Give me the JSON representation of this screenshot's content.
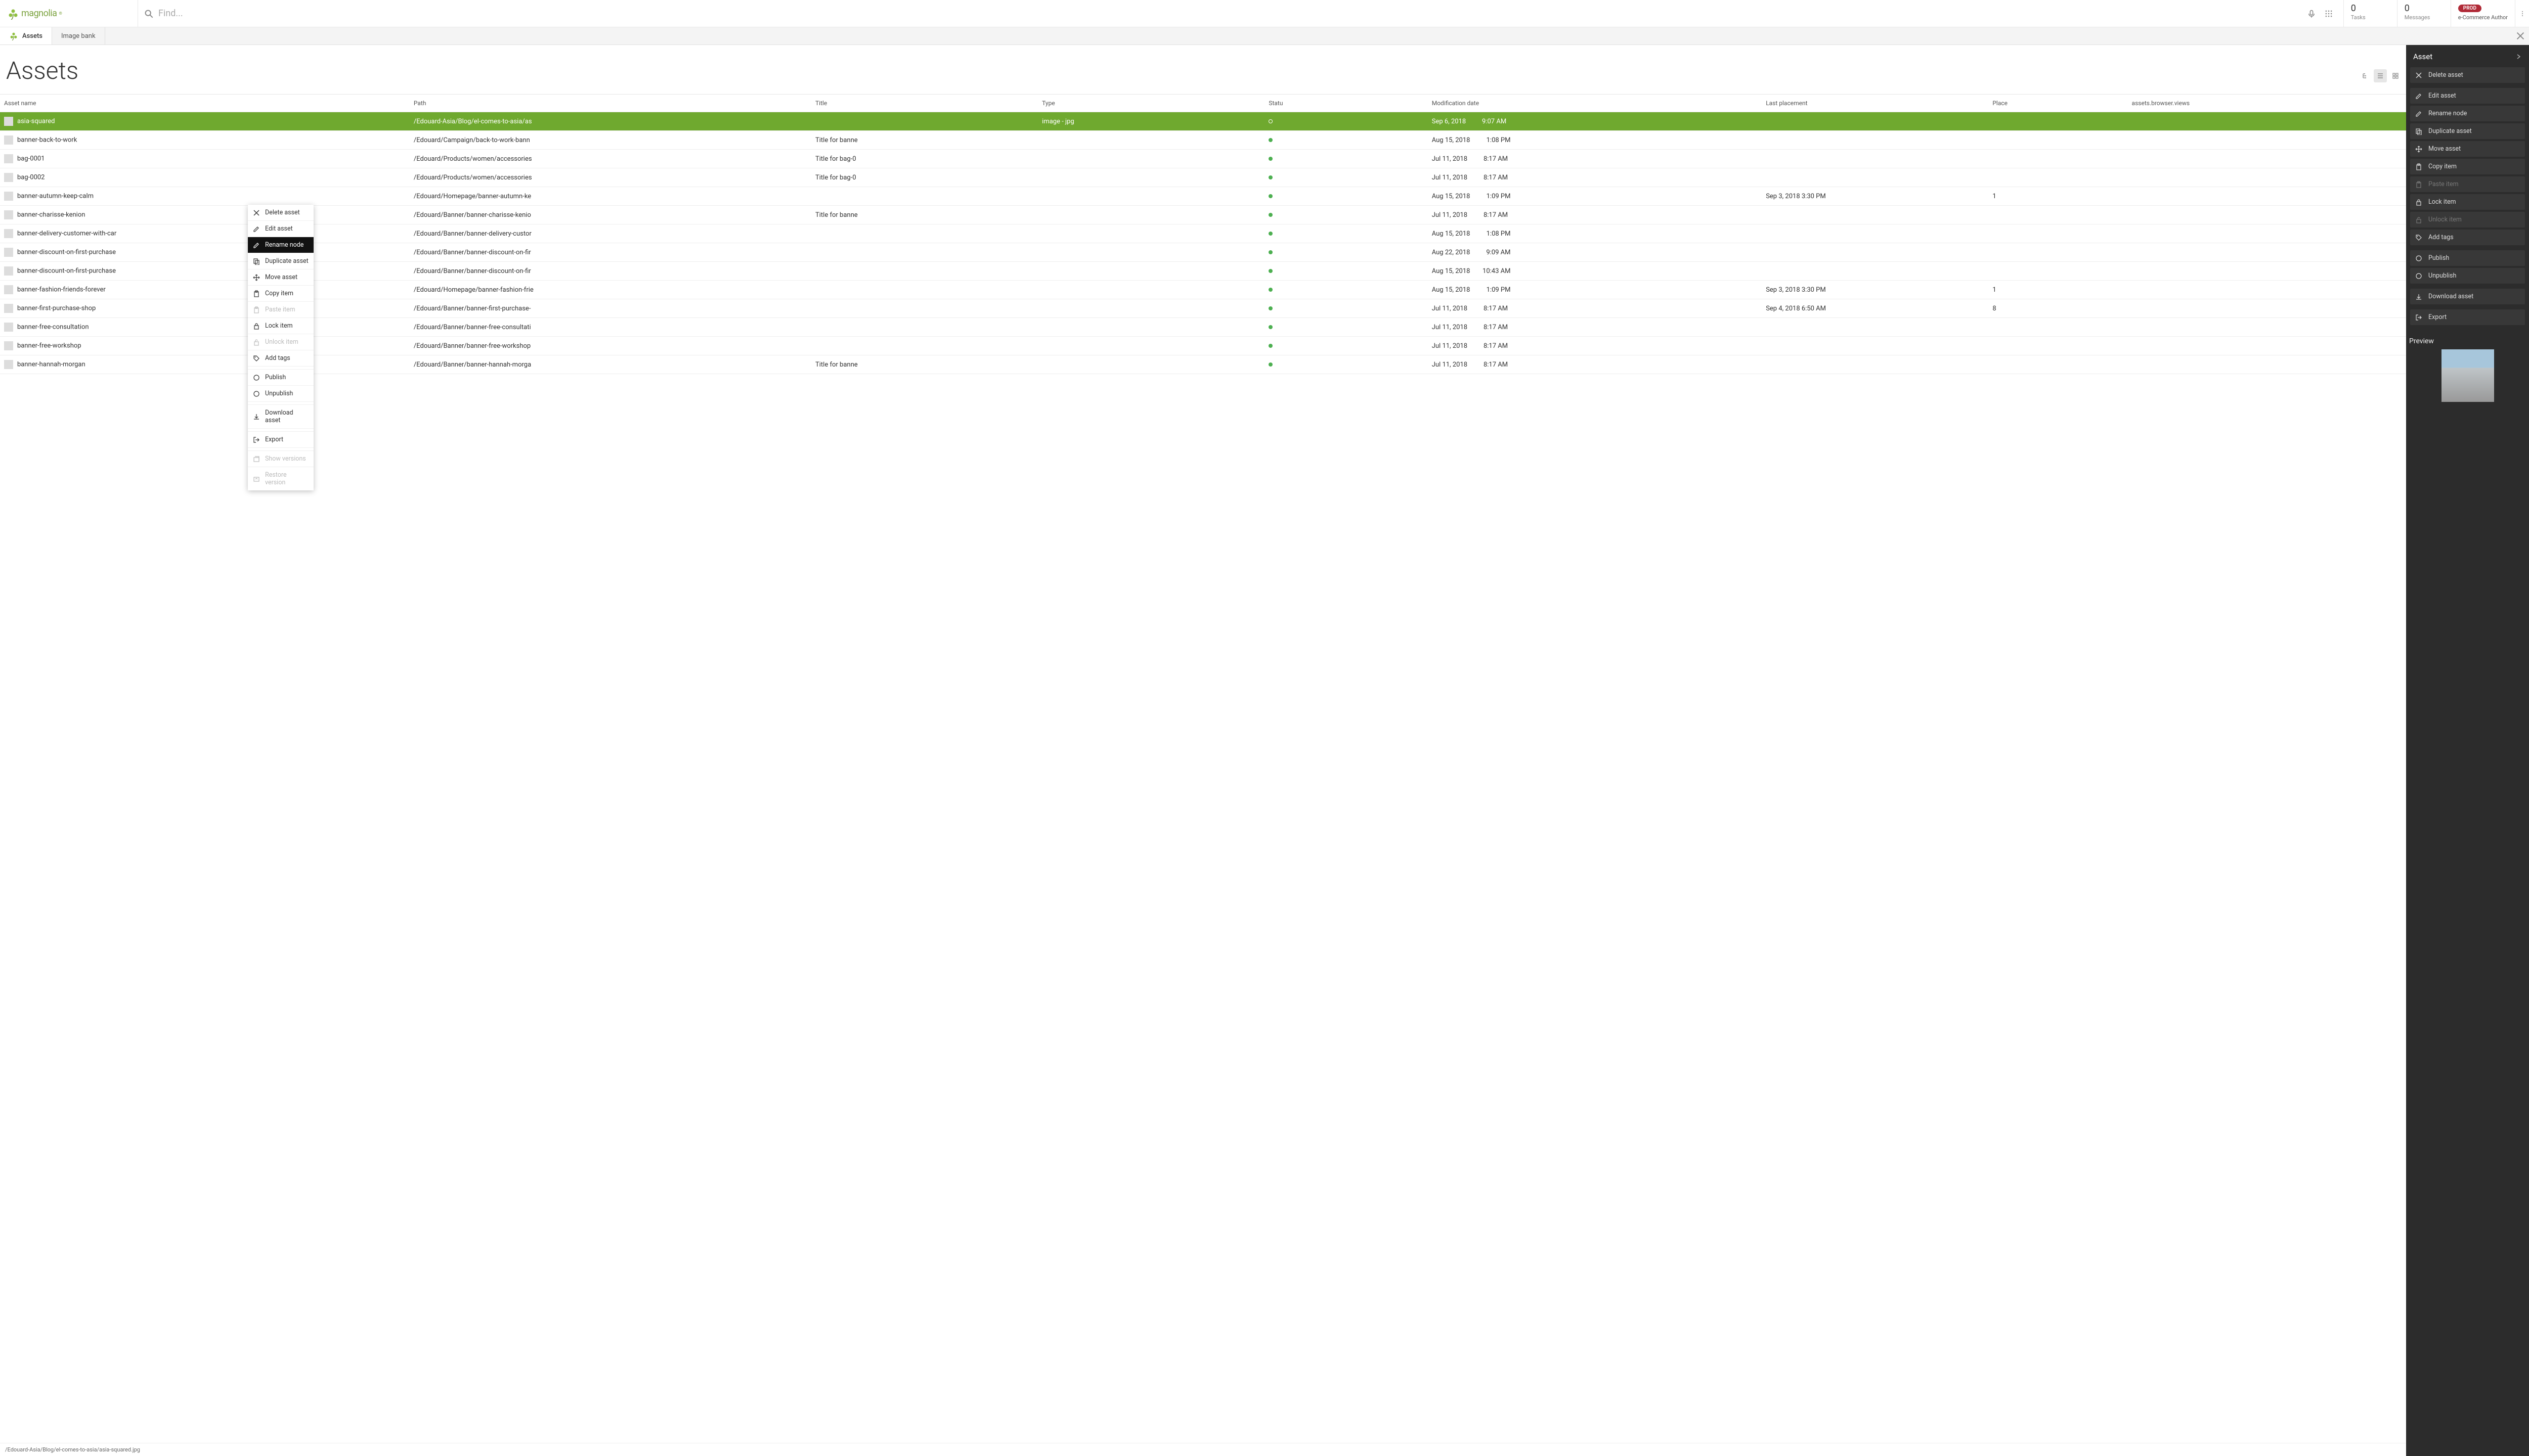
{
  "brand": {
    "name": "magnolia"
  },
  "search": {
    "placeholder": "Find..."
  },
  "header_stats": {
    "tasks": {
      "count": "0",
      "label": "Tasks"
    },
    "messages": {
      "count": "0",
      "label": "Messages"
    }
  },
  "env": {
    "badge": "PROD",
    "role": "e-Commerce Author"
  },
  "tabs": [
    {
      "label": "Assets",
      "active": true
    },
    {
      "label": "Image bank",
      "active": false
    }
  ],
  "page_title": "Assets",
  "columns": {
    "name": "Asset name",
    "path": "Path",
    "title": "Title",
    "type": "Type",
    "status": "Statu",
    "mod": "Modification date",
    "last": "Last placement",
    "place": "Place",
    "views": "assets.browser.views"
  },
  "rows": [
    {
      "name": "asia-squared",
      "path": "/Edouard-Asia/Blog/el-comes-to-asia/as",
      "title": "",
      "type": "image - jpg",
      "status": "empty",
      "mod_date": "Sep 6, 2018",
      "mod_time": "9:07 AM",
      "last": "",
      "place": "",
      "selected": true
    },
    {
      "name": "banner-back-to-work",
      "path": "/Edouard/Campaign/back-to-work-bann",
      "title": "Title for banne",
      "type": "",
      "status": "green",
      "mod_date": "Aug 15, 2018",
      "mod_time": "1:08 PM",
      "last": "",
      "place": ""
    },
    {
      "name": "bag-0001",
      "path": "/Edouard/Products/women/accessories",
      "title": "Title for bag-0",
      "type": "",
      "status": "green",
      "mod_date": "Jul 11, 2018",
      "mod_time": "8:17 AM",
      "last": "",
      "place": ""
    },
    {
      "name": "bag-0002",
      "path": "/Edouard/Products/women/accessories",
      "title": "Title for bag-0",
      "type": "",
      "status": "green",
      "mod_date": "Jul 11, 2018",
      "mod_time": "8:17 AM",
      "last": "",
      "place": ""
    },
    {
      "name": "banner-autumn-keep-calm",
      "path": "/Edouard/Homepage/banner-autumn-ke",
      "title": "",
      "type": "",
      "status": "green",
      "mod_date": "Aug 15, 2018",
      "mod_time": "1:09 PM",
      "last": "Sep 3, 2018  3:30 PM",
      "place": "1"
    },
    {
      "name": "banner-charisse-kenion",
      "path": "/Edouard/Banner/banner-charisse-kenio",
      "title": "Title for banne",
      "type": "",
      "status": "green",
      "mod_date": "Jul 11, 2018",
      "mod_time": "8:17 AM",
      "last": "",
      "place": ""
    },
    {
      "name": "banner-delivery-customer-with-car",
      "path": "/Edouard/Banner/banner-delivery-custor",
      "title": "",
      "type": "",
      "status": "green",
      "mod_date": "Aug 15, 2018",
      "mod_time": "1:08 PM",
      "last": "",
      "place": ""
    },
    {
      "name": "banner-discount-on-first-purchase",
      "path": "/Edouard/Banner/banner-discount-on-fir",
      "title": "",
      "type": "",
      "status": "green",
      "mod_date": "Aug 22, 2018",
      "mod_time": "9:09 AM",
      "last": "",
      "place": ""
    },
    {
      "name": "banner-discount-on-first-purchase",
      "path": "/Edouard/Banner/banner-discount-on-fir",
      "title": "",
      "type": "",
      "status": "green",
      "mod_date": "Aug 15, 2018",
      "mod_time": "10:43 AM",
      "last": "",
      "place": ""
    },
    {
      "name": "banner-fashion-friends-forever",
      "path": "/Edouard/Homepage/banner-fashion-frie",
      "title": "",
      "type": "",
      "status": "green",
      "mod_date": "Aug 15, 2018",
      "mod_time": "1:09 PM",
      "last": "Sep 3, 2018  3:30 PM",
      "place": "1"
    },
    {
      "name": "banner-first-purchase-shop",
      "path": "/Edouard/Banner/banner-first-purchase-",
      "title": "",
      "type": "",
      "status": "green",
      "mod_date": "Jul 11, 2018",
      "mod_time": "8:17 AM",
      "last": "Sep 4, 2018  6:50 AM",
      "place": "8"
    },
    {
      "name": "banner-free-consultation",
      "path": "/Edouard/Banner/banner-free-consultati",
      "title": "",
      "type": "",
      "status": "green",
      "mod_date": "Jul 11, 2018",
      "mod_time": "8:17 AM",
      "last": "",
      "place": ""
    },
    {
      "name": "banner-free-workshop",
      "path": "/Edouard/Banner/banner-free-workshop",
      "title": "",
      "type": "",
      "status": "green",
      "mod_date": "Jul 11, 2018",
      "mod_time": "8:17 AM",
      "last": "",
      "place": ""
    },
    {
      "name": "banner-hannah-morgan",
      "path": "/Edouard/Banner/banner-hannah-morga",
      "title": "Title for banne",
      "type": "",
      "status": "green",
      "mod_date": "Jul 11, 2018",
      "mod_time": "8:17 AM",
      "last": "",
      "place": ""
    }
  ],
  "footer_path": "/Edouard-Asia/Blog/el-comes-to-asia/asia-squared.jpg",
  "context_menu": [
    {
      "label": "Delete asset",
      "icon": "x"
    },
    {
      "label": "Edit asset",
      "icon": "pencil"
    },
    {
      "label": "Rename node",
      "icon": "pencil",
      "hover": true
    },
    {
      "label": "Duplicate asset",
      "icon": "copy"
    },
    {
      "label": "Move asset",
      "icon": "move"
    },
    {
      "label": "Copy item",
      "icon": "clip"
    },
    {
      "label": "Paste item",
      "icon": "clip",
      "disabled": true
    },
    {
      "label": "Lock item",
      "icon": "lock"
    },
    {
      "label": "Unlock item",
      "icon": "unlock",
      "disabled": true
    },
    {
      "label": "Add tags",
      "icon": "tag"
    },
    {
      "divider": true
    },
    {
      "label": "Publish",
      "icon": "circle"
    },
    {
      "label": "Unpublish",
      "icon": "circle"
    },
    {
      "divider": true
    },
    {
      "label": "Download asset",
      "icon": "download"
    },
    {
      "divider": true
    },
    {
      "label": "Export",
      "icon": "export"
    },
    {
      "divider": true
    },
    {
      "label": "Show versions",
      "icon": "versions",
      "disabled": true
    },
    {
      "label": "Restore version",
      "icon": "restore",
      "disabled": true
    }
  ],
  "sidepanel": {
    "title": "Asset",
    "actions": [
      {
        "label": "Delete asset",
        "icon": "x"
      },
      {
        "gap": true
      },
      {
        "label": "Edit asset",
        "icon": "pencil"
      },
      {
        "label": "Rename node",
        "icon": "pencil"
      },
      {
        "label": "Duplicate asset",
        "icon": "copy"
      },
      {
        "label": "Move asset",
        "icon": "move"
      },
      {
        "label": "Copy item",
        "icon": "clip"
      },
      {
        "label": "Paste item",
        "icon": "clip",
        "disabled": true
      },
      {
        "label": "Lock item",
        "icon": "lock"
      },
      {
        "label": "Unlock item",
        "icon": "unlock",
        "disabled": true
      },
      {
        "label": "Add tags",
        "icon": "tag"
      },
      {
        "gap": true
      },
      {
        "label": "Publish",
        "icon": "circle"
      },
      {
        "label": "Unpublish",
        "icon": "circle"
      },
      {
        "gap": true
      },
      {
        "label": "Download asset",
        "icon": "download"
      },
      {
        "gap": true
      },
      {
        "label": "Export",
        "icon": "export"
      }
    ],
    "preview_title": "Preview"
  }
}
